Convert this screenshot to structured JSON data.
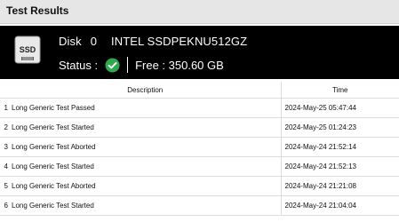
{
  "panel": {
    "title": "Test Results"
  },
  "disk": {
    "icon": "ssd-drive-icon",
    "icon_label": "SSD",
    "label": "Disk",
    "number": "0",
    "model": "INTEL SSDPEKNU512GZ",
    "status_label": "Status :",
    "status_icon": "check-circle-icon",
    "status_color": "#2fa84f",
    "free_text": "Free : 350.60 GB"
  },
  "table": {
    "columns": [
      "",
      "Description",
      "Time"
    ],
    "rows": [
      {
        "index": "1",
        "description": "Long Generic Test Passed",
        "time": "2024-May-25 05:47:44"
      },
      {
        "index": "2",
        "description": "Long Generic Test Started",
        "time": "2024-May-25 01:24:23"
      },
      {
        "index": "3",
        "description": "Long Generic Test Aborted",
        "time": "2024-May-24 21:52:14"
      },
      {
        "index": "4",
        "description": "Long Generic Test Started",
        "time": "2024-May-24 21:52:13"
      },
      {
        "index": "5",
        "description": "Long Generic Test Aborted",
        "time": "2024-May-24 21:21:08"
      },
      {
        "index": "6",
        "description": "Long Generic Test Started",
        "time": "2024-May-24 21:04:04"
      }
    ]
  }
}
